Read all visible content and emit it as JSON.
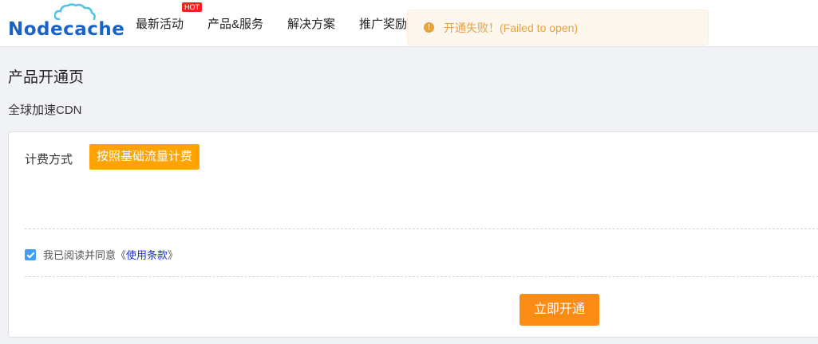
{
  "header": {
    "logo_text": "Nodecache",
    "nav_items": [
      {
        "label": "最新活动",
        "badge": "HOT"
      },
      {
        "label": "产品&服务"
      },
      {
        "label": "解决方案"
      },
      {
        "label": "推广奖励"
      }
    ]
  },
  "toast": {
    "icon": "warning-icon",
    "message": "开通失败！(Failed to open)"
  },
  "page": {
    "title": "产品开通页",
    "product_name": "全球加速CDN"
  },
  "form": {
    "billing_label": "计费方式",
    "billing_option": "按照基础流量计费",
    "agree_checked": true,
    "agree_text": "我已阅读并同意",
    "terms_open": "《",
    "terms_link": "使用条款",
    "terms_close": "》",
    "submit_label": "立即开通"
  },
  "colors": {
    "brand_blue": "#1a63c6",
    "accent_orange": "#fa8c16",
    "billing_orange": "#ffa300",
    "warning": "#e6a23c"
  }
}
